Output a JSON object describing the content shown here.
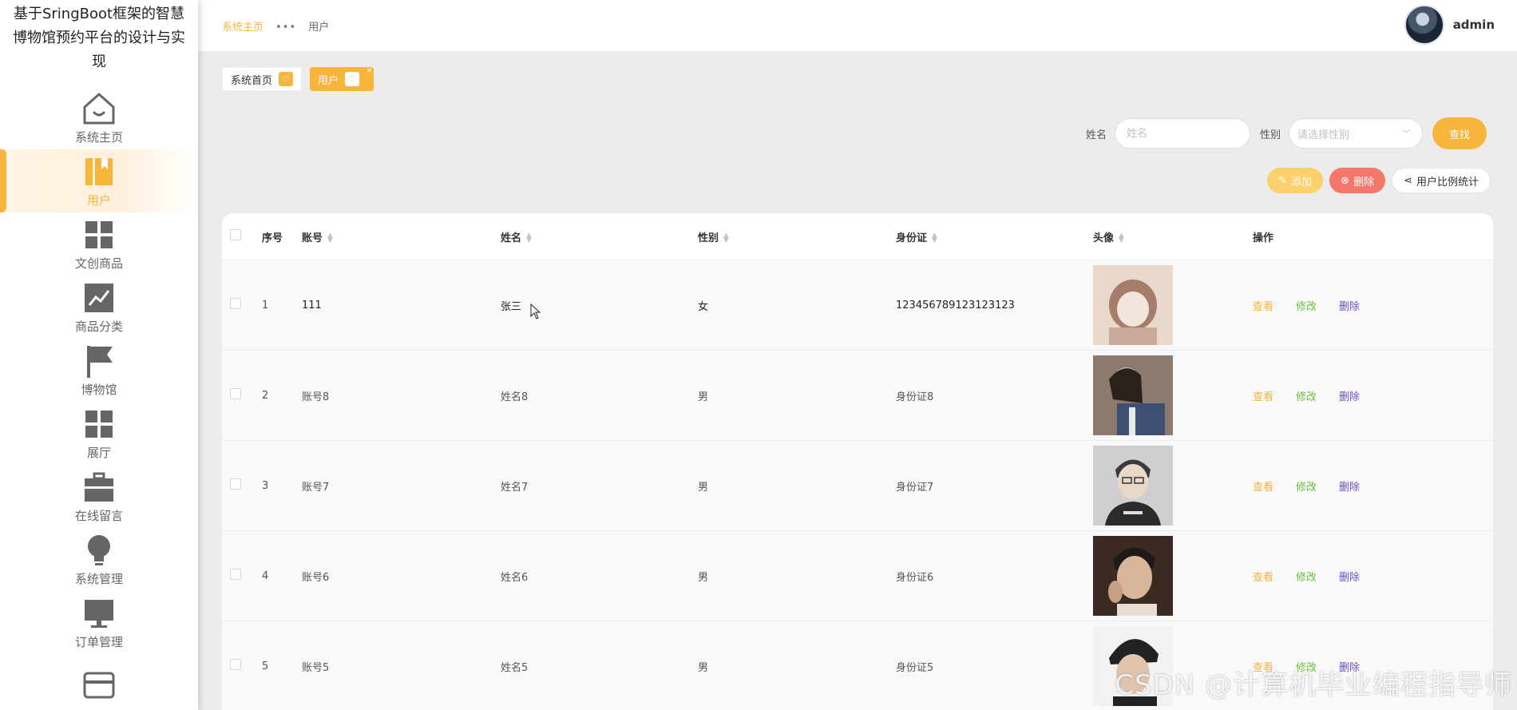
{
  "sidebar": {
    "brand": "基于SringBoot框架的智慧博物馆预约平台的设计与实现",
    "items": [
      {
        "label": "系统主页",
        "icon": "home-icon"
      },
      {
        "label": "用户",
        "icon": "user-book-icon"
      },
      {
        "label": "文创商品",
        "icon": "grid-icon"
      },
      {
        "label": "商品分类",
        "icon": "trend-chart-icon"
      },
      {
        "label": "博物馆",
        "icon": "flag-icon"
      },
      {
        "label": "展厅",
        "icon": "grid-icon"
      },
      {
        "label": "在线留言",
        "icon": "briefcase-icon"
      },
      {
        "label": "系统管理",
        "icon": "bulb-icon"
      },
      {
        "label": "订单管理",
        "icon": "monitor-icon"
      },
      {
        "label": "",
        "icon": "card-icon"
      }
    ]
  },
  "header": {
    "breadcrumb_home": "系统主页",
    "breadcrumb_current": "用户",
    "username": "admin"
  },
  "tags": {
    "home": "系统首页",
    "current": "用户"
  },
  "search": {
    "name_label": "姓名",
    "name_placeholder": "姓名",
    "sex_label": "性别",
    "sex_placeholder": "请选择性别",
    "search_button": "查找"
  },
  "actions": {
    "add": "添加",
    "delete": "删除",
    "stats": "用户比例统计"
  },
  "table": {
    "headers": {
      "index": "序号",
      "account": "账号",
      "name": "姓名",
      "sex": "性别",
      "id_card": "身份证",
      "avatar": "头像",
      "operations": "操作"
    },
    "op_labels": {
      "view": "查看",
      "edit": "修改",
      "delete": "删除"
    },
    "rows": [
      {
        "index": "1",
        "account": "111",
        "name": "张三",
        "sex": "女",
        "id_card": "123456789123123123",
        "photo_colors": [
          "#e8d9cc",
          "#a67c6a",
          "#f2e6dc"
        ]
      },
      {
        "index": "2",
        "account": "账号8",
        "name": "姓名8",
        "sex": "男",
        "id_card": "身份证8",
        "photo_colors": [
          "#8c7a6e",
          "#3d4f73",
          "#d9cfc6"
        ]
      },
      {
        "index": "3",
        "account": "账号7",
        "name": "姓名7",
        "sex": "男",
        "id_card": "身份证7",
        "photo_colors": [
          "#cfcfcf",
          "#2b2b2b",
          "#e9d8c8"
        ]
      },
      {
        "index": "4",
        "account": "账号6",
        "name": "姓名6",
        "sex": "男",
        "id_card": "身份证6",
        "photo_colors": [
          "#3a2a22",
          "#d9b59a",
          "#1f1a17"
        ]
      },
      {
        "index": "5",
        "account": "账号5",
        "name": "姓名5",
        "sex": "男",
        "id_card": "身份证5",
        "photo_colors": [
          "#f2f2f2",
          "#222222",
          "#e0c4ae"
        ]
      }
    ]
  },
  "watermark": "CSDN @计算机毕业编程指导师",
  "colors": {
    "accent": "#f7b53b",
    "edit": "#67c23a",
    "delete_link": "#6d4dc7",
    "delete_button": "#f5766a"
  }
}
